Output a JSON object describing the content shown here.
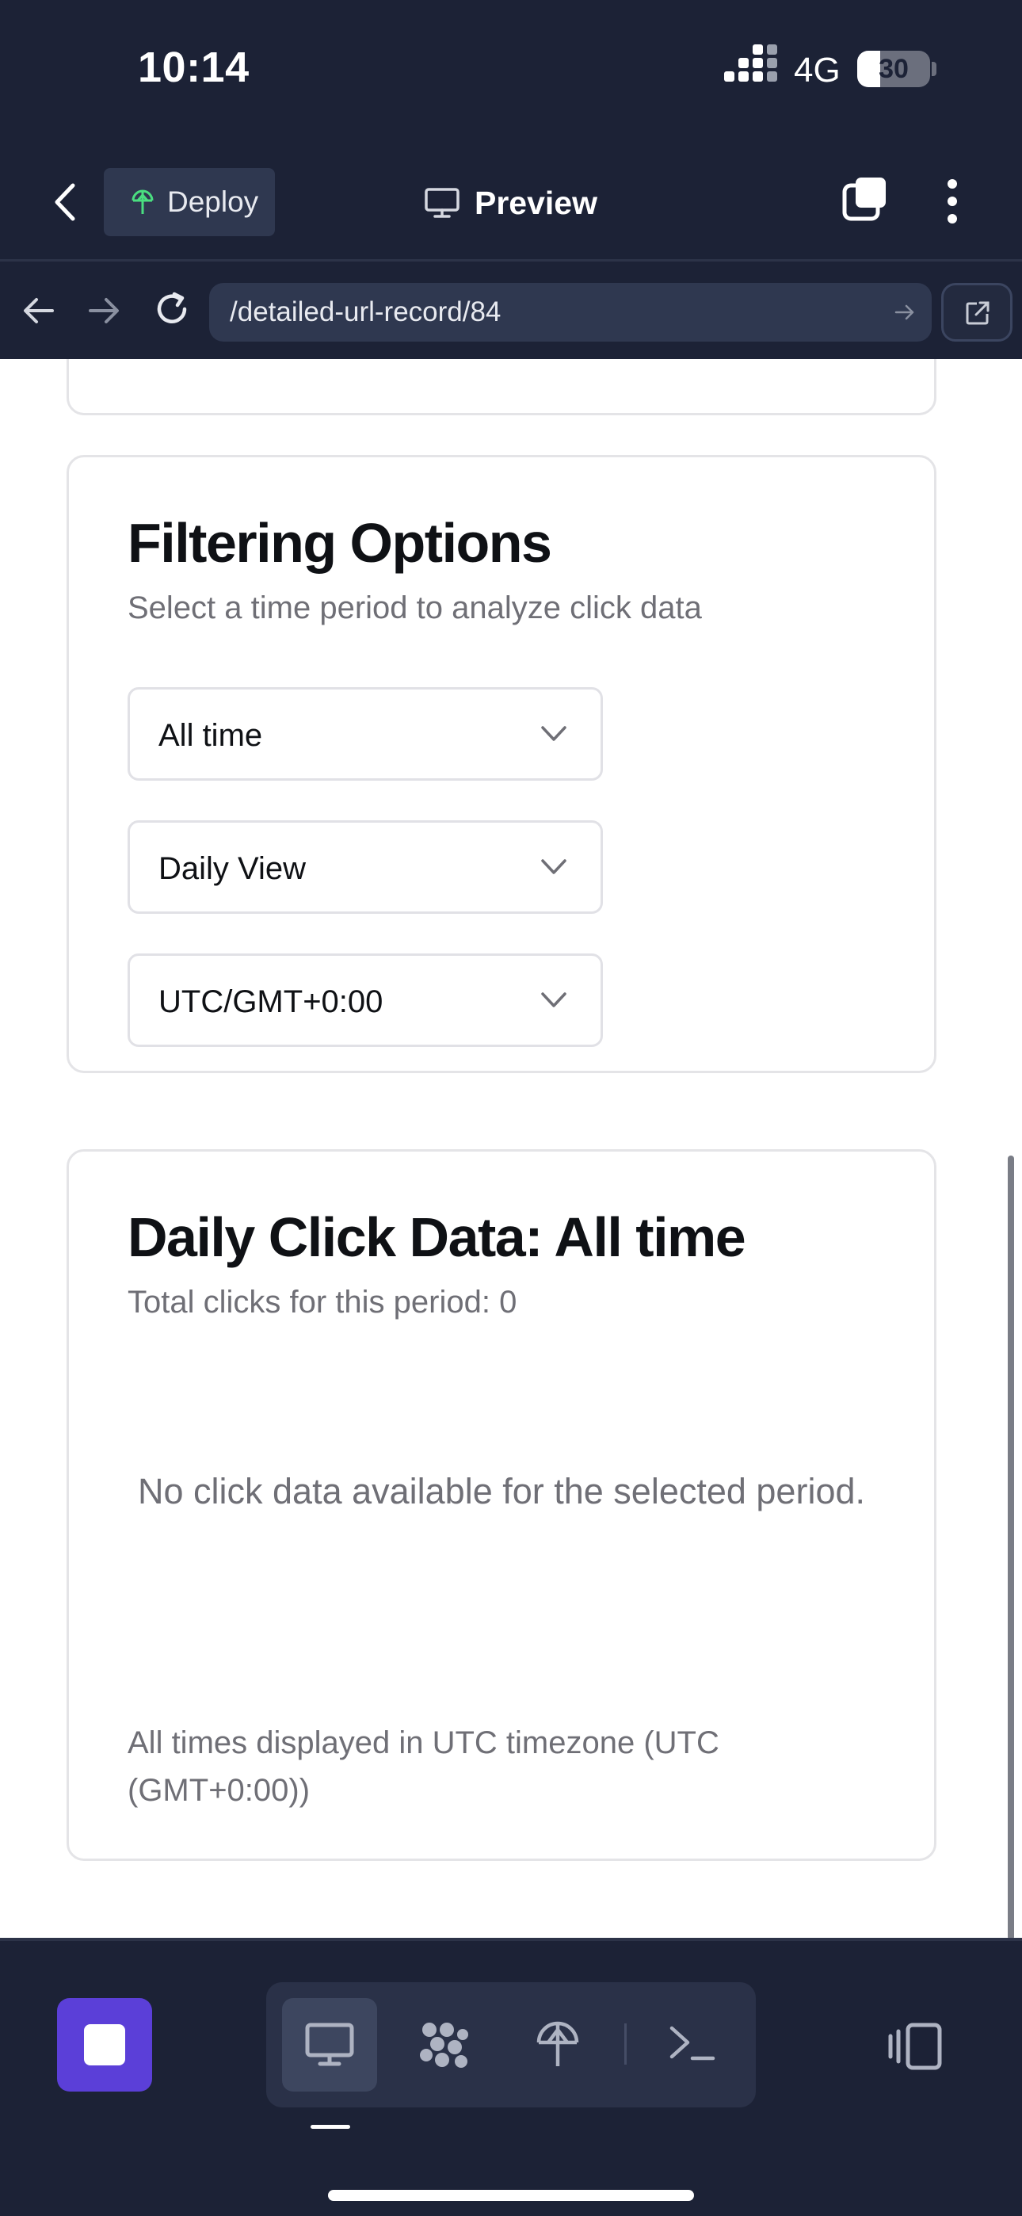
{
  "status_bar": {
    "time": "10:14",
    "network": "4G",
    "battery_level": "30"
  },
  "toolbar": {
    "deploy_label": "Deploy",
    "preview_label": "Preview"
  },
  "browser": {
    "url": "/detailed-url-record/84"
  },
  "filtering": {
    "title": "Filtering Options",
    "subtitle": "Select a time period to analyze click data",
    "time_period_value": "All time",
    "view_value": "Daily View",
    "timezone_value": "UTC/GMT+0:00"
  },
  "daily": {
    "title": "Daily Click Data: All time",
    "total_clicks": "Total clicks for this period: 0",
    "empty_message": "No click data available for the selected period.",
    "timezone_note": "All times displayed in UTC timezone (UTC (GMT+0:00))"
  },
  "colors": {
    "chrome_bg": "#1c2236",
    "accent": "#5b3fd8",
    "deploy_icon": "#4ade80"
  },
  "icons": {
    "back": "chevron-left-icon",
    "deploy": "antenna-icon",
    "preview": "monitor-icon",
    "tabs": "tabs-icon",
    "menu": "more-vertical-icon",
    "nav_back": "arrow-left-icon",
    "nav_forward": "arrow-right-icon",
    "reload": "reload-icon",
    "go": "arrow-right-icon",
    "open_external": "external-link-icon",
    "stop": "stop-icon",
    "preview_mode": "monitor-icon",
    "workflow_mode": "workflow-icon",
    "deploy_mode": "antenna-icon",
    "console_mode": "terminal-icon",
    "panel_toggle": "panel-toggle-icon",
    "dropdown": "chevron-down-icon"
  }
}
